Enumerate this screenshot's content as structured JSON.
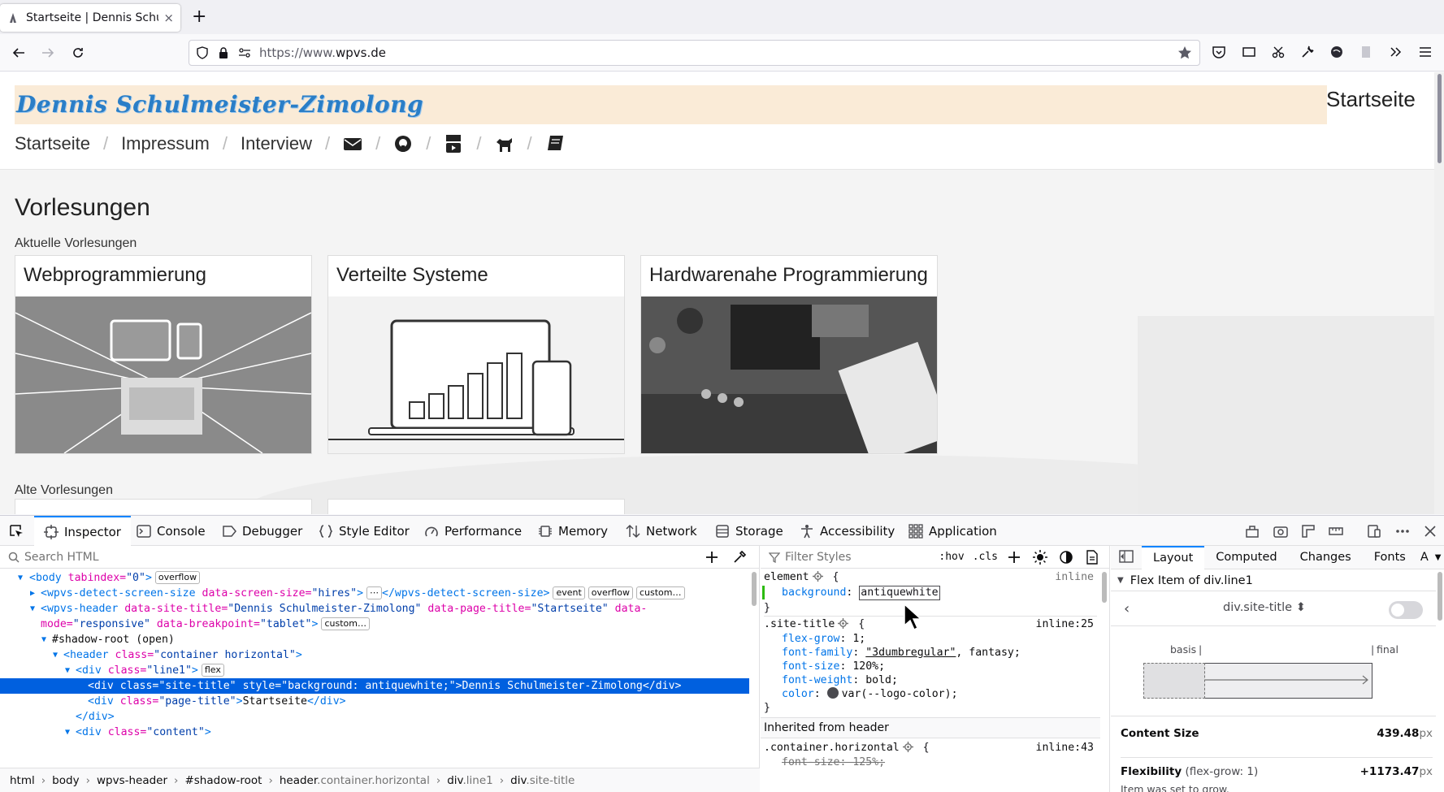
{
  "browser": {
    "tab_title": "Startseite | Dennis Schulmeister-Zimolong",
    "new_tab_label": "+",
    "tab_close": "×",
    "url_scheme": "https://www.",
    "url_host": "wpvs.de"
  },
  "site": {
    "title": "Dennis Schulmeister-Zimolong",
    "page_title": "Startseite",
    "nav": {
      "home": "Startseite",
      "imprint": "Impressum",
      "interview": "Interview",
      "separator": "/",
      "icons": [
        "mail-icon",
        "github-icon",
        "youtube-icon",
        "dog-icon",
        "book-icon"
      ]
    },
    "lectures_heading": "Vorlesungen",
    "current_heading": "Aktuelle Vorlesungen",
    "old_heading": "Alte Vorlesungen",
    "cards": [
      {
        "title": "Webprogrammierung"
      },
      {
        "title": "Verteilte Systeme"
      },
      {
        "title": "Hardwarenahe Programmierung"
      }
    ],
    "colors": {
      "title_bg": "#faebd7",
      "logo": "#2a7ec7"
    }
  },
  "devtools": {
    "tabs": {
      "inspector": "Inspector",
      "console": "Console",
      "debugger": "Debugger",
      "style_editor": "Style Editor",
      "performance": "Performance",
      "memory": "Memory",
      "network": "Network",
      "storage": "Storage",
      "accessibility": "Accessibility",
      "application": "Application"
    },
    "markup": {
      "search_placeholder": "Search HTML",
      "tree": {
        "l1": {
          "tag": "<body",
          "attr": " tabindex=",
          "val": "\"0\"",
          "end": ">",
          "badge": "overflow"
        },
        "l2": {
          "tag": "<wpvs-detect-screen-size",
          "attr": " data-screen-size=",
          "val": "\"hires\"",
          "end": ">",
          "ellipsis": "⋯",
          "close": "</wpvs-detect-screen-size>",
          "b1": "event",
          "b2": "overflow",
          "b3": "custom…"
        },
        "l3": {
          "tag": "<wpvs-header",
          "a1": " data-site-title=",
          "v1": "\"Dennis Schulmeister-Zimolong\"",
          "a2": " data-page-title=",
          "v2": "\"Startseite\"",
          "a3": " data-"
        },
        "l4": {
          "a1": "mode=",
          "v1": "\"responsive\"",
          "a2": " data-breakpoint=",
          "v2": "\"tablet\"",
          "end": ">",
          "badge": "custom…"
        },
        "l5": {
          "text": "#shadow-root (open)"
        },
        "l6": {
          "tag": "<header",
          "attr": " class=",
          "val": "\"container horizontal\"",
          "end": ">"
        },
        "l7": {
          "tag": "<div",
          "attr": " class=",
          "val": "\"line1\"",
          "end": ">",
          "badge": "flex"
        },
        "l8": {
          "tag": "<div",
          "a1": " class=",
          "v1": "\"site-title\"",
          "a2": " style=",
          "v2": "\"background: antiquewhite;\"",
          "end": ">",
          "text": "Dennis Schulmeister-Zimolong",
          "close": "</div>"
        },
        "l9": {
          "tag": "<div",
          "attr": " class=",
          "val": "\"page-title\"",
          "end": ">",
          "text": "Startseite",
          "close": "</div>"
        },
        "l10": {
          "close": "</div>"
        },
        "l11": {
          "tag": "<div",
          "attr": " class=",
          "val": "\"content\"",
          "end": ">"
        }
      },
      "breadcrumbs": {
        "b1": "html",
        "b2": "body",
        "b3": "wpvs-header",
        "b4": "#shadow-root",
        "b5_tag": "header",
        "b5_cls": ".container.horizontal",
        "b6_tag": "div",
        "b6_cls": ".line1",
        "b7_tag": "div",
        "b7_cls": ".site-title",
        "sep": "›"
      }
    },
    "rules": {
      "filter_placeholder": "Filter Styles",
      "hov": ":hov",
      "cls": ".cls",
      "element_selector": "element",
      "brace_open": " {",
      "brace_close": "}",
      "inline_label": "inline",
      "element_prop": "background",
      "element_value": "antiquewhite",
      "site_title_selector": ".site-title",
      "site_title_source": "inline:25",
      "decls": [
        {
          "p": "flex-grow",
          "v": "1;"
        },
        {
          "p": "font-family",
          "v_link": "\"3dumbregular\"",
          "v": ", fantasy;"
        },
        {
          "p": "font-size",
          "v": "120%;"
        },
        {
          "p": "font-weight",
          "v": "bold;"
        },
        {
          "p": "color",
          "v": "var(--logo-color);"
        }
      ],
      "inherited_header": "Inherited from header",
      "container_selector": ".container.horizontal",
      "container_source": "inline:43",
      "container_decl": "font-size: 125%;"
    },
    "layout": {
      "tabs": {
        "layout": "Layout",
        "computed": "Computed",
        "changes": "Changes",
        "fonts": "Fonts",
        "more": "A"
      },
      "flex_item_header": "Flex Item of div.line1",
      "item_selector": "div.site-title",
      "basis_label": "basis",
      "final_label": "final",
      "content_size_label": "Content Size",
      "content_size_value": "439.48",
      "content_size_unit": "px",
      "flexibility_label": "Flexibility",
      "flexibility_sub": "(flex-grow: 1)",
      "flexibility_value": "+1173.47",
      "flexibility_unit": "px",
      "note": "Item was set to grow."
    }
  }
}
